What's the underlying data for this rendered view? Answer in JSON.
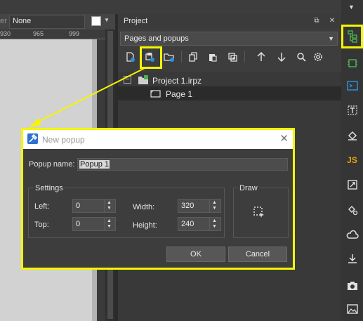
{
  "toolbar_left": {
    "label_cut": "er",
    "combo_value": "None"
  },
  "ruler": {
    "ticks": [
      "930",
      "965",
      "999"
    ]
  },
  "panel": {
    "title": "Project",
    "mode_select": "Pages and popups",
    "tree": {
      "project": "Project 1.irpz",
      "page": "Page 1"
    }
  },
  "right_strip": {
    "js_label": "JS"
  },
  "dialog": {
    "title": "New popup",
    "popup_name_label": "Popup name:",
    "popup_name_value": "Popup 1",
    "settings_label": "Settings",
    "left_label": "Left:",
    "left_value": "0",
    "top_label": "Top:",
    "top_value": "0",
    "width_label": "Width:",
    "width_value": "320",
    "height_label": "Height:",
    "height_value": "240",
    "draw_label": "Draw",
    "ok_label": "OK",
    "cancel_label": "Cancel"
  },
  "colors": {
    "highlight": "#f5f500",
    "accent_blue": "#2f8fd8",
    "js": "#e8a20c",
    "tree_green": "#4caf50"
  }
}
